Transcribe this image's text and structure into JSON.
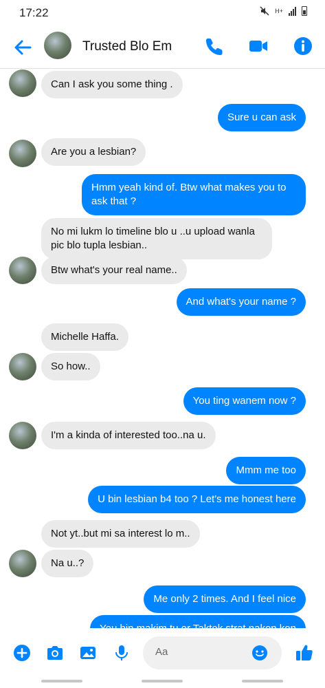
{
  "status_bar": {
    "time": "17:22",
    "network_label": "H+"
  },
  "header": {
    "contact_name": "Trusted Blo Em",
    "icons": [
      "back-arrow-icon",
      "phone-icon",
      "video-camera-icon",
      "info-icon"
    ]
  },
  "messages": [
    {
      "dir": "in",
      "text": "Can I ask you some thing ."
    },
    {
      "dir": "out",
      "text": "Sure u can ask"
    },
    {
      "dir": "in",
      "text": "Are you a lesbian?"
    },
    {
      "dir": "out",
      "text": "Hmm yeah kind of. Btw what makes you to ask that ?"
    },
    {
      "dir": "in",
      "text": "No mi lukm lo timeline blo u ..u upload wanla pic blo tupla lesbian.."
    },
    {
      "dir": "in",
      "text": "Btw what's your real name.."
    },
    {
      "dir": "out",
      "text": "And what's your name ?"
    },
    {
      "dir": "in",
      "text": "Michelle Haffa."
    },
    {
      "dir": "in",
      "text": "So how.."
    },
    {
      "dir": "out",
      "text": "You ting wanem now ?"
    },
    {
      "dir": "in",
      "text": "I'm a kinda of interested too..na u."
    },
    {
      "dir": "out",
      "text": "Mmm me too"
    },
    {
      "dir": "out",
      "text": "U bin lesbian b4 too ? Let's me  honest here"
    },
    {
      "dir": "in",
      "text": "Not yt..but mi sa interest lo m.."
    },
    {
      "dir": "in",
      "text": "Na u..?"
    },
    {
      "dir": "out",
      "text": "Me only 2 times. And I feel nice"
    },
    {
      "dir": "out",
      "text": "You bin makim tu or Taktok strat nakon kon"
    }
  ],
  "composer": {
    "placeholder": "Aa",
    "icons": [
      "plus-icon",
      "camera-icon",
      "gallery-icon",
      "microphone-icon",
      "emoji-icon",
      "thumbs-up-icon"
    ]
  },
  "colors": {
    "accent": "#0084ff",
    "incoming_bubble": "#eaeaea",
    "background": "#ffffff"
  }
}
